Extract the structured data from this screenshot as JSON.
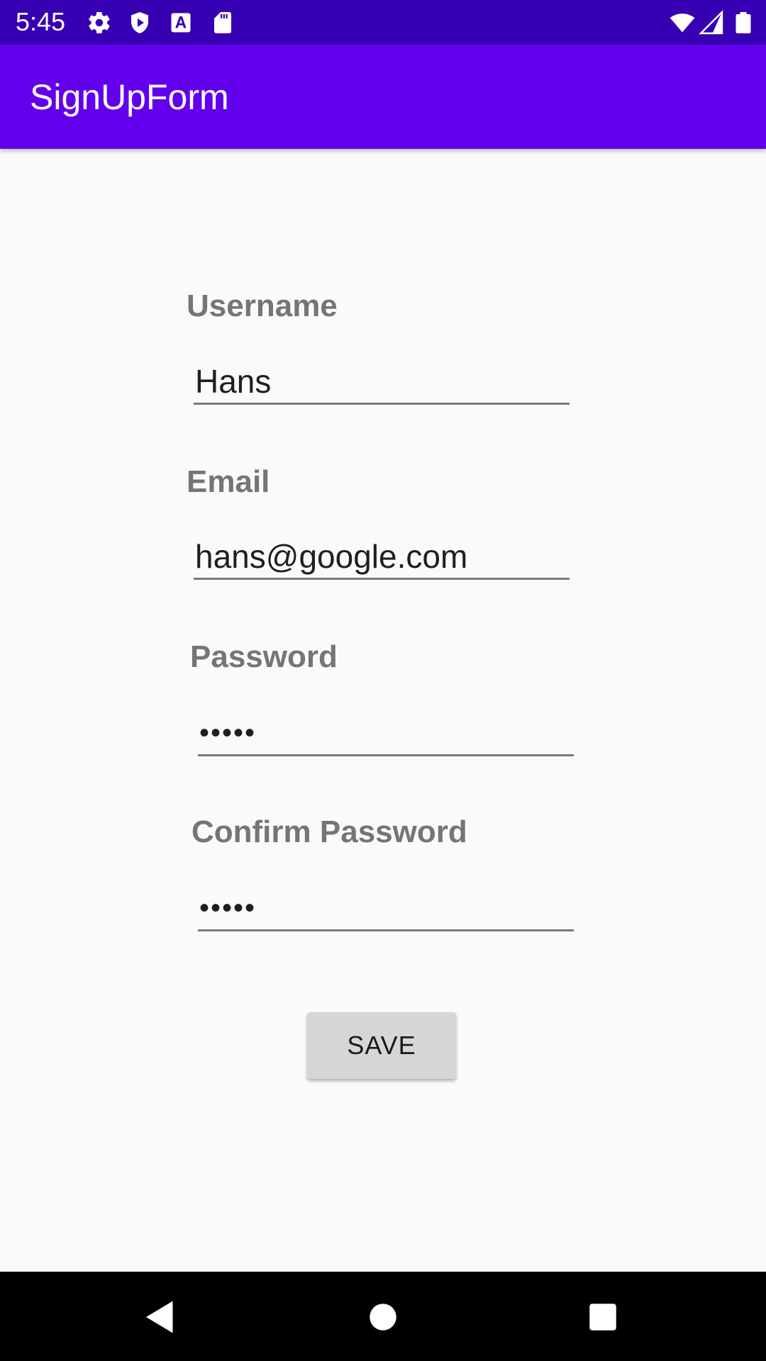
{
  "status_bar": {
    "time": "5:45",
    "left_icons": [
      "settings-gear-icon",
      "shield-play-icon",
      "font-a-icon",
      "sd-card-icon"
    ],
    "right_icons": [
      "wifi-icon",
      "cell-signal-icon",
      "battery-icon"
    ]
  },
  "app_bar": {
    "title": "SignUpForm"
  },
  "form": {
    "username": {
      "label": "Username",
      "value": "Hans"
    },
    "email": {
      "label": "Email",
      "value": "hans@google.com"
    },
    "password": {
      "label": "Password",
      "value": "•••••"
    },
    "confirm_password": {
      "label": "Confirm Password",
      "value": "•••••"
    },
    "save_label": "SAVE"
  },
  "nav_bar": {
    "icons": [
      "back-triangle-icon",
      "home-circle-icon",
      "recents-square-icon"
    ]
  },
  "colors": {
    "status_bar": "#3700b3",
    "app_bar": "#6200ee",
    "background": "#fafafa",
    "label_gray": "#757575",
    "button_gray": "#d6d6d6"
  }
}
